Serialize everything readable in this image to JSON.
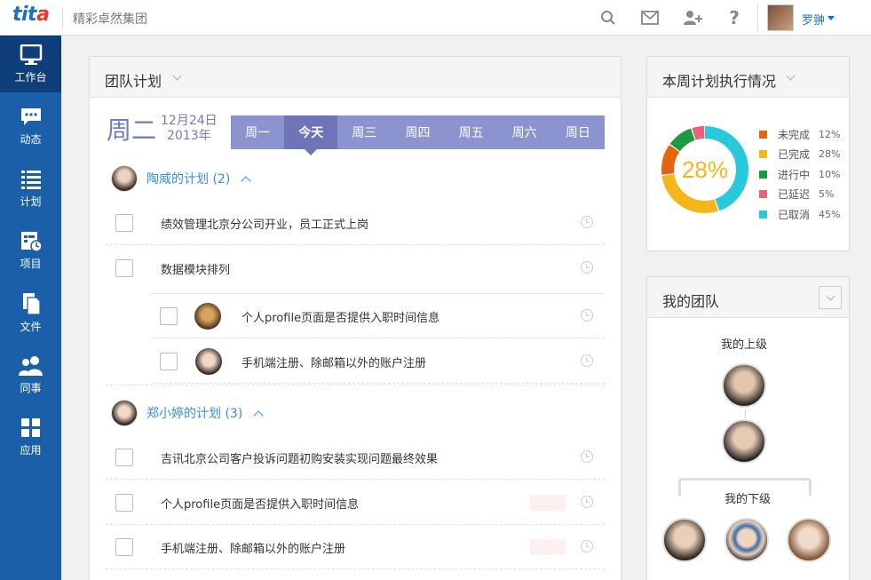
{
  "header": {
    "logo_main": "tit",
    "logo_accent": "a",
    "company": "精彩卓然集团",
    "username": "罗翀"
  },
  "sidebar": {
    "items": [
      {
        "label": "工作台",
        "icon": "monitor-icon"
      },
      {
        "label": "动态",
        "icon": "chat-bubble-icon"
      },
      {
        "label": "计划",
        "icon": "list-icon"
      },
      {
        "label": "项目",
        "icon": "project-clock-icon"
      },
      {
        "label": "文件",
        "icon": "document-icon"
      },
      {
        "label": "同事",
        "icon": "people-icon"
      },
      {
        "label": "应用",
        "icon": "grid-icon"
      }
    ]
  },
  "plan": {
    "title": "团队计划",
    "day": "周二",
    "date_line1": "12月24日",
    "date_line2": "2013年",
    "weekdays": [
      "周一",
      "今天",
      "周三",
      "周四",
      "周五",
      "周六",
      "周日"
    ],
    "groups": [
      {
        "name": "陶威的计划 (2)",
        "tasks": [
          "绩效管理北京分公司开业，员工正式上岗",
          "数据模块排列"
        ],
        "subtasks": [
          "个人profile页面是否提供入职时间信息",
          "手机端注册、除邮箱以外的账户注册"
        ]
      },
      {
        "name": "郑小婷的计划 (3)",
        "tasks": [
          "吉讯北京公司客户投诉问题初购安装实现问题最终效果",
          "个人profile页面是否提供入职时间信息",
          "手机端注册、除邮箱以外的账户注册"
        ]
      }
    ]
  },
  "weekly": {
    "title": "本周计划执行情况",
    "center_label": "28%",
    "items": [
      {
        "label": "未完成",
        "pct": "12%",
        "value": 12,
        "color": "#e8630e"
      },
      {
        "label": "已完成",
        "pct": "28%",
        "value": 28,
        "color": "#f5b61a"
      },
      {
        "label": "进行中",
        "pct": "10%",
        "value": 10,
        "color": "#1c9a43"
      },
      {
        "label": "已延迟",
        "pct": "5%",
        "value": 5,
        "color": "#e8637a"
      },
      {
        "label": "已取消",
        "pct": "45%",
        "value": 45,
        "color": "#28c9dd"
      }
    ]
  },
  "team": {
    "title": "我的团队",
    "superior_label": "我的上级",
    "subordinate_label": "我的下级"
  },
  "colors": {
    "sidebar": "#1b5fa8",
    "sidebar_active": "#0f3f7a",
    "weekbar": "#8c94cf",
    "link": "#3b8fd5"
  }
}
